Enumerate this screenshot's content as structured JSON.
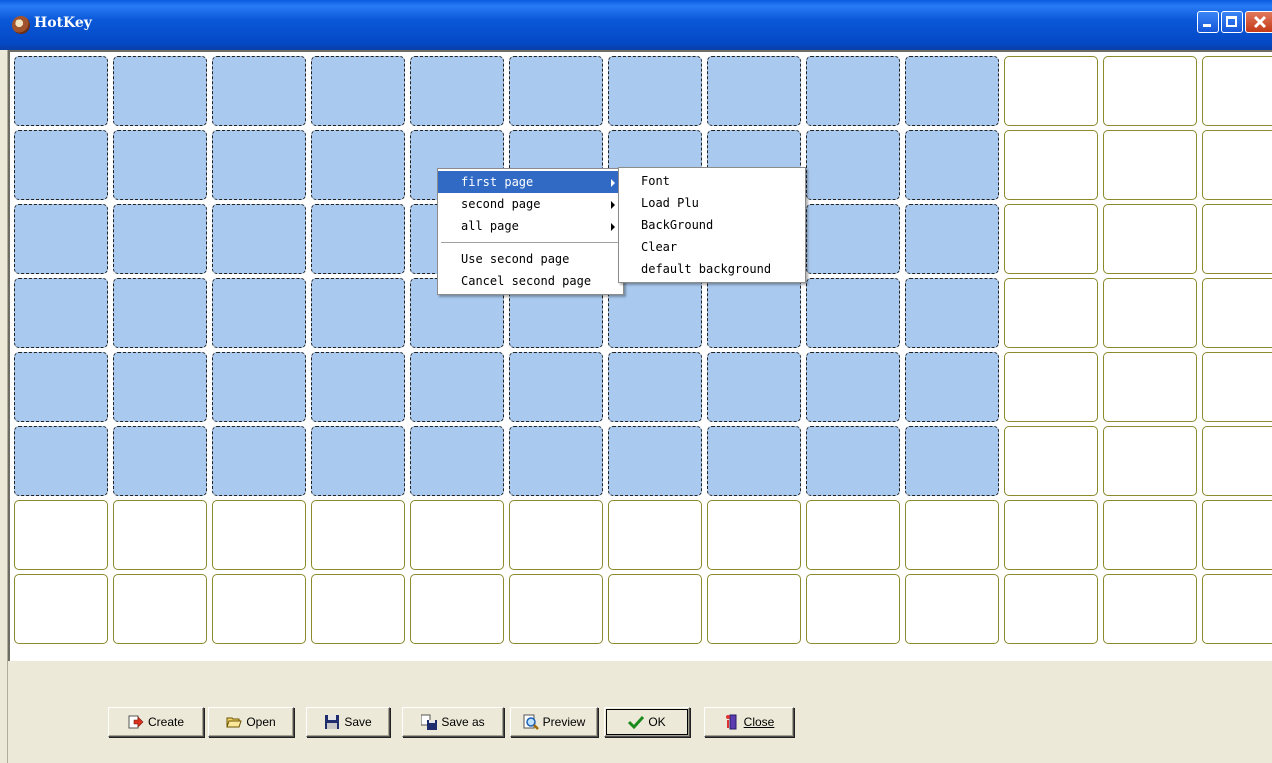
{
  "window": {
    "title": "HotKey"
  },
  "grid": {
    "columns": 13,
    "rows": 8,
    "selected_columns": 10,
    "selected_rows": 6,
    "selected_color": "#a9c9ee",
    "cell_border_color": "#8b8b2e"
  },
  "context_menu": {
    "items": [
      {
        "label": "first page",
        "has_submenu": true
      },
      {
        "label": "second page",
        "has_submenu": true
      },
      {
        "label": "all page",
        "has_submenu": true
      },
      {
        "label": "Use second page"
      },
      {
        "label": "Cancel second page"
      }
    ],
    "submenu": [
      {
        "label": "Font"
      },
      {
        "label": "Load Plu"
      },
      {
        "label": "BackGround"
      },
      {
        "label": "Clear"
      },
      {
        "label": "default background"
      }
    ]
  },
  "toolbar": {
    "create": "Create",
    "open": "Open",
    "save": "Save",
    "save_as": "Save as",
    "preview": "Preview",
    "ok": "OK",
    "close": "Close"
  },
  "icons": {
    "create": "create-arrow-icon",
    "open": "folder-open-icon",
    "save": "floppy-disk-icon",
    "save_as": "save-as-icon",
    "preview": "magnifier-icon",
    "ok": "checkmark-icon",
    "close": "exit-door-icon"
  }
}
